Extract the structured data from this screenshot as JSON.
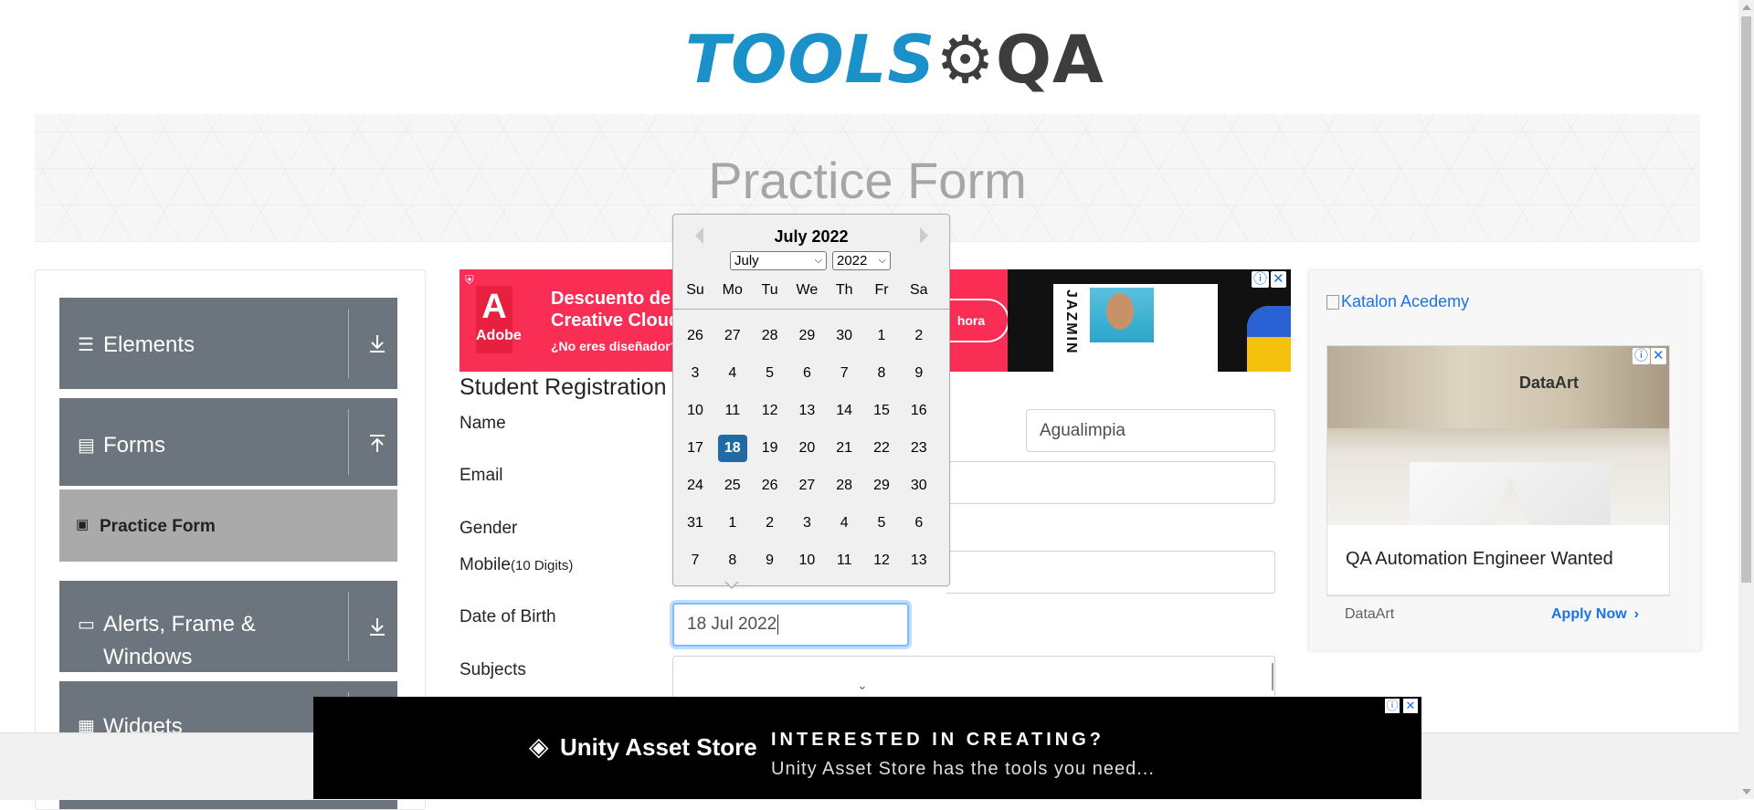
{
  "brand": {
    "tools": "TOOLS",
    "qa": "QA"
  },
  "banner": {
    "title": "Practice Form"
  },
  "sidebar": {
    "groups": [
      {
        "label": "Elements"
      },
      {
        "label": "Forms"
      },
      {
        "label_line1": "Alerts, Frame &",
        "label_line2": "Windows"
      },
      {
        "label": "Widgets"
      }
    ],
    "active_item": "Practice Form"
  },
  "form": {
    "title": "Student Registration",
    "labels": {
      "name": "Name",
      "email": "Email",
      "gender": "Gender",
      "mobile": "Mobile",
      "mobile_hint": "(10 Digits)",
      "dob": "Date of Birth",
      "subjects": "Subjects"
    },
    "last_name_value": "Agualimpia",
    "dob_value": "18 Jul 2022"
  },
  "datepicker": {
    "current_month": "July 2022",
    "month_select": "July",
    "year_select": "2022",
    "weekdays": [
      "Su",
      "Mo",
      "Tu",
      "We",
      "Th",
      "Fr",
      "Sa"
    ],
    "weeks": [
      [
        "26",
        "27",
        "28",
        "29",
        "30",
        "1",
        "2"
      ],
      [
        "3",
        "4",
        "5",
        "6",
        "7",
        "8",
        "9"
      ],
      [
        "10",
        "11",
        "12",
        "13",
        "14",
        "15",
        "16"
      ],
      [
        "17",
        "18",
        "19",
        "20",
        "21",
        "22",
        "23"
      ],
      [
        "24",
        "25",
        "26",
        "27",
        "28",
        "29",
        "30"
      ],
      [
        "31",
        "1",
        "2",
        "3",
        "4",
        "5",
        "6"
      ],
      [
        "7",
        "8",
        "9",
        "10",
        "11",
        "12",
        "13"
      ]
    ],
    "selected_day": "18"
  },
  "ads": {
    "adobe_line1": "Descuento de n",
    "adobe_line2": "Creative Cloud",
    "adobe_line3": "¿No eres diseñador? Ne",
    "adobe_brand": "Adobe",
    "adobe_cta": "hora",
    "jazmin": "JAZMIN",
    "katalon_alt": "Katalon Acedemy",
    "dataart_logo": "DataArt",
    "dataart_headline": "QA Automation Engineer Wanted",
    "dataart_advertiser": "DataArt",
    "dataart_cta": "Apply Now",
    "unity_logo": "Unity Asset Store",
    "unity_line1": "INTERESTED IN CREATING?",
    "unity_line2": "Unity Asset Store has the tools you need..."
  },
  "colors": {
    "tools_blue": "#1a91c8",
    "sidebar_gray": "#6c757d",
    "selected_day": "#216ba5",
    "link_blue": "#1a73e8"
  }
}
